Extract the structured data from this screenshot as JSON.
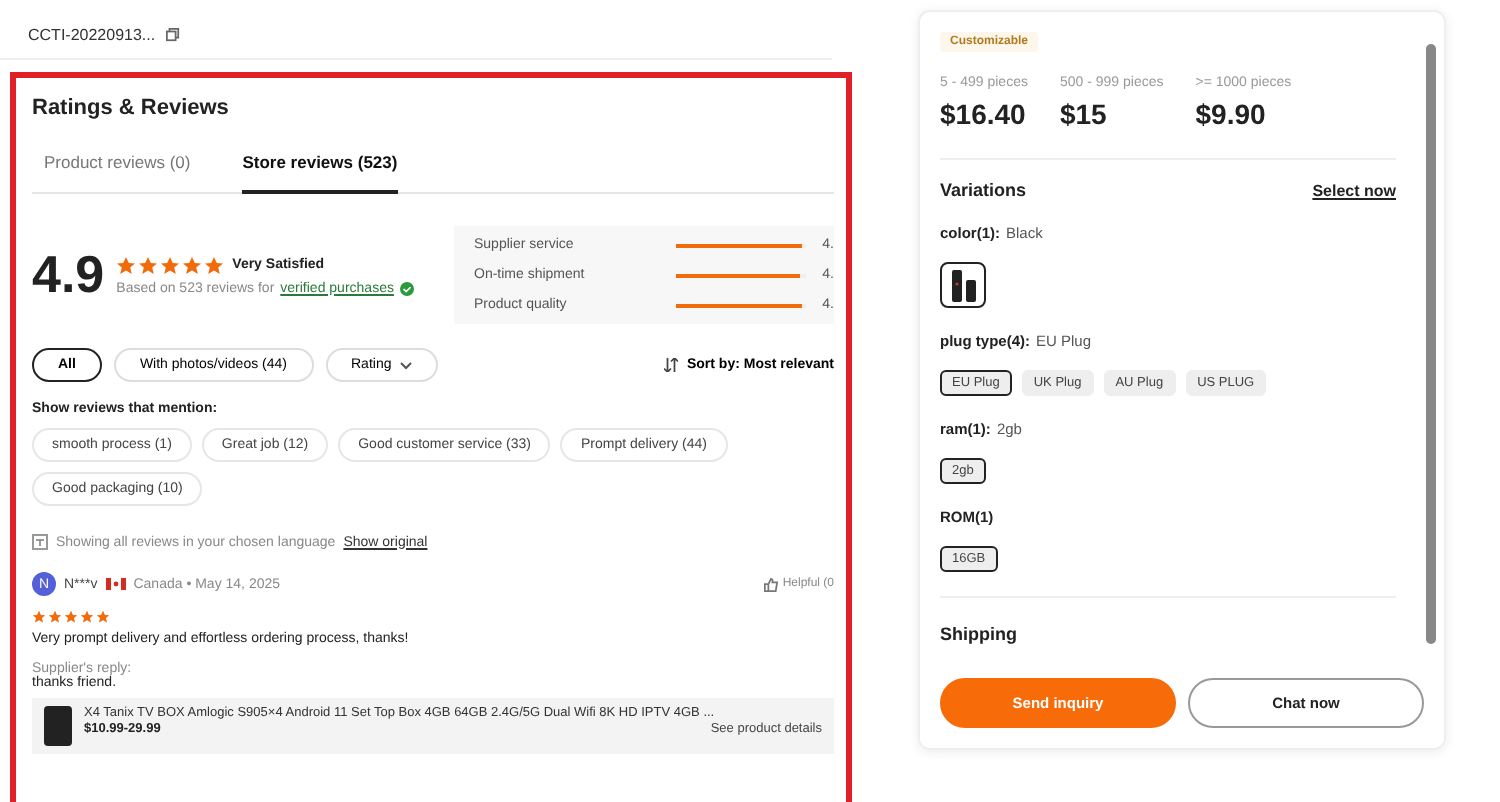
{
  "product_code": "CCTI-20220913...",
  "reviews": {
    "title": "Ratings & Reviews",
    "tabs": [
      {
        "label": "Product reviews (0)",
        "selected": false
      },
      {
        "label": "Store reviews (523)",
        "selected": true
      }
    ],
    "score": "4.9",
    "stars": 5,
    "verdict": "Very Satisfied",
    "based_on": "Based on 523 reviews for",
    "verified_link": "verified purchases",
    "metrics": [
      {
        "label": "Supplier service",
        "level": 0.97,
        "value": "4."
      },
      {
        "label": "On-time shipment",
        "level": 0.95,
        "value": "4."
      },
      {
        "label": "Product quality",
        "level": 0.97,
        "value": "4."
      }
    ],
    "filters": [
      {
        "label": "All",
        "selected": true,
        "kind": "chip"
      },
      {
        "label": "With photos/videos (44)",
        "selected": false,
        "kind": "chip"
      },
      {
        "label": "Rating",
        "selected": false,
        "kind": "dropdown"
      }
    ],
    "sort_label": "Sort by: Most relevant",
    "mention_title": "Show reviews that mention:",
    "mentions": [
      "smooth process (1)",
      "Great job (12)",
      "Good customer service (33)",
      "Prompt delivery (44)",
      "Good packaging (10)"
    ],
    "language_note": "Showing all reviews in your chosen language",
    "show_original": "Show original",
    "review": {
      "initial": "N",
      "author": "N***v",
      "meta": "Canada • May 14, 2025",
      "helpful": "Helpful (0",
      "stars": 5,
      "text": "Very prompt delivery and effortless ordering process, thanks!",
      "reply_label": "Supplier's reply:",
      "reply": "thanks friend.",
      "product": "X4 Tanix TV BOX Amlogic S905×4 Android 11 Set Top Box 4GB 64GB 2.4G/5G Dual Wifi 8K HD IPTV 4GB ...",
      "price": "$10.99-29.99",
      "details": "See product details"
    }
  },
  "order": {
    "badge": "Customizable",
    "tiers": [
      {
        "range": "5 - 499 pieces",
        "price": "$16.40"
      },
      {
        "range": "500 - 999 pieces",
        "price": "$15"
      },
      {
        "range": ">= 1000 pieces",
        "price": "$9.90"
      }
    ],
    "variations_title": "Variations",
    "select_now": "Select now",
    "groups": [
      {
        "name": "color(1):",
        "value": "Black",
        "kind": "image",
        "options": [
          {
            "selected": true
          }
        ]
      },
      {
        "name": "plug type(4):",
        "value": "EU Plug",
        "kind": "text",
        "options": [
          {
            "label": "EU Plug",
            "selected": true
          },
          {
            "label": "UK Plug",
            "selected": false
          },
          {
            "label": "AU Plug",
            "selected": false
          },
          {
            "label": "US PLUG",
            "selected": false
          }
        ]
      },
      {
        "name": "ram(1):",
        "value": "2gb",
        "kind": "text",
        "options": [
          {
            "label": "2gb",
            "selected": true
          }
        ]
      },
      {
        "name": "ROM(1)",
        "kind": "text",
        "options": [
          {
            "label": "16GB",
            "selected": true
          }
        ]
      }
    ],
    "shipping_title": "Shipping",
    "buttons": [
      {
        "label": "Send inquiry",
        "kind": "primary"
      },
      {
        "label": "Chat now",
        "kind": "secondary"
      }
    ]
  }
}
